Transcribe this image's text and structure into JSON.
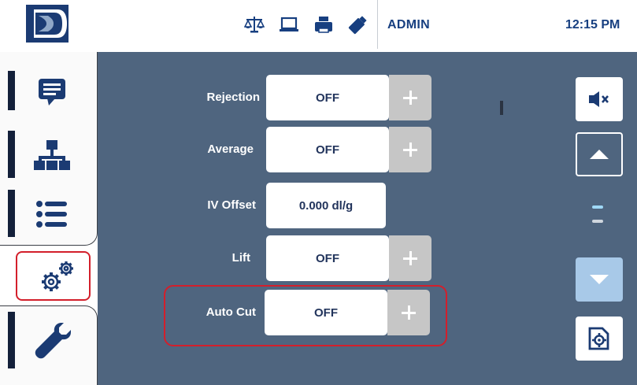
{
  "header": {
    "logo": "company-logo",
    "status_icons": [
      "scale-icon",
      "laptop-icon",
      "printer-icon",
      "usb-drive-icon"
    ],
    "user": "ADMIN",
    "time": "12:15 PM"
  },
  "nav": {
    "items": [
      {
        "name": "messages",
        "icon": "chat-icon"
      },
      {
        "name": "network",
        "icon": "network-icon"
      },
      {
        "name": "list",
        "icon": "list-icon"
      },
      {
        "name": "settings",
        "icon": "gears-icon",
        "active": true
      },
      {
        "name": "tools",
        "icon": "wrench-icon"
      }
    ]
  },
  "settings": {
    "rejection": {
      "label": "Rejection",
      "value": "OFF"
    },
    "average": {
      "label": "Average",
      "value": "OFF"
    },
    "iv_offset": {
      "label": "IV Offset",
      "value": "0.000 dl/g"
    },
    "lift": {
      "label": "Lift",
      "value": "OFF"
    },
    "auto_cut": {
      "label": "Auto Cut",
      "value": "OFF"
    }
  },
  "right_controls": {
    "mute_icon": "speaker-muted-icon",
    "up_icon": "triangle-up-icon",
    "down_icon": "triangle-down-icon",
    "page_settings_icon": "page-settings-icon"
  },
  "colors": {
    "panel": "#4f657f",
    "header_text": "#173f80",
    "highlight": "#d31f2b",
    "nav_bar": "#13203a"
  }
}
